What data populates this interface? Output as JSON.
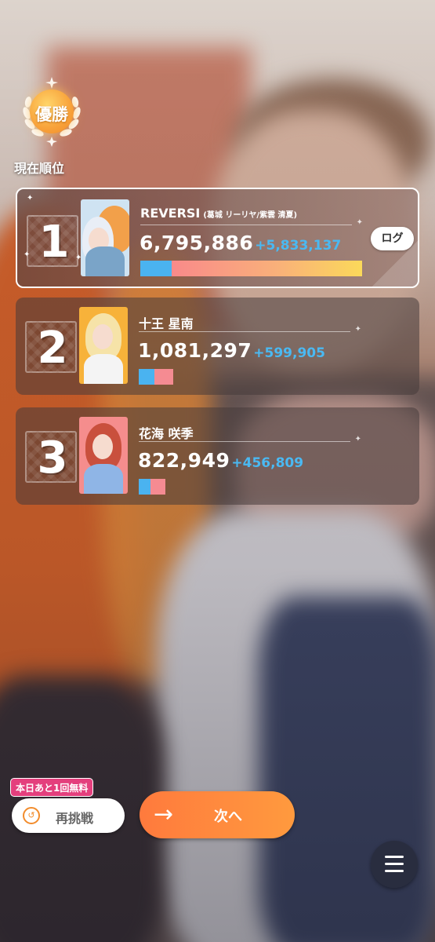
{
  "header": {
    "badge_label": "優勝",
    "current_rank_label": "現在順位"
  },
  "rankings": [
    {
      "rank": "1",
      "name": "REVERSI",
      "sub_name": "(葛城 リーリヤ/紫雲 清夏)",
      "score": "6,795,886",
      "delta": "+5,833,137",
      "bar": {
        "blue_fraction": 0.14,
        "warm_fraction": 0.86
      }
    },
    {
      "rank": "2",
      "name": "十王 星南",
      "score": "1,081,297",
      "delta": "+599,905",
      "bar": {
        "blue_fraction": 0.45,
        "pink_fraction": 0.55
      }
    },
    {
      "rank": "3",
      "name": "花海 咲季",
      "score": "822,949",
      "delta": "+456,809",
      "bar": {
        "blue_fraction": 0.45,
        "pink_fraction": 0.55
      }
    }
  ],
  "controls": {
    "log_label": "ログ",
    "free_tag": "本日あと1回無料",
    "retry_label": "再挑戦",
    "next_label": "次へ",
    "menu_icon": "hamburger-menu-icon",
    "retry_icon": "refresh-clock-icon",
    "next_icon": "arrow-right-icon"
  },
  "colors": {
    "accent_orange": "#ff8a3d",
    "delta_blue": "#4ab9f2",
    "free_tag_pink": "#e43f7d",
    "badge_gold": "#f8a23a"
  }
}
